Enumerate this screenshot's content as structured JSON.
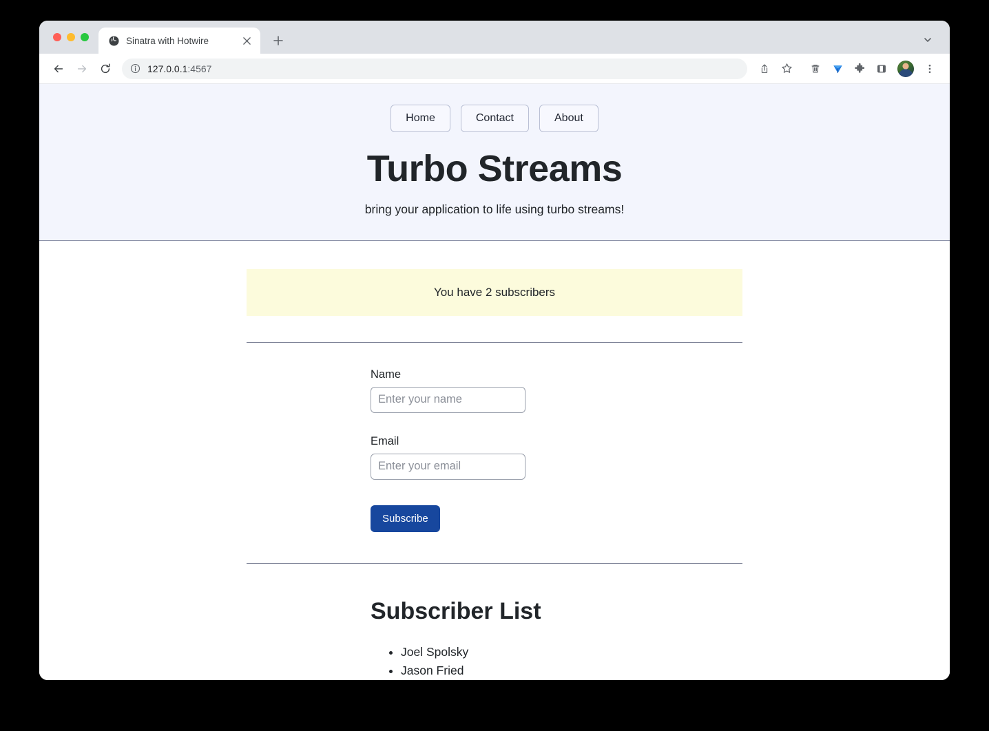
{
  "browser": {
    "tab": {
      "title": "Sinatra with Hotwire",
      "favicon": "globe-icon",
      "close": "✕"
    },
    "new_tab_label": "+",
    "tablist_chevron": "chevron-down-icon",
    "toolbar": {
      "back": "back-arrow-icon",
      "forward": "forward-arrow-icon",
      "reload": "reload-icon",
      "site_info": "info-circle-icon",
      "url_host": "127.0.0.1",
      "url_port": ":4567",
      "share": "share-icon",
      "bookmark": "star-icon",
      "trash": "trash-icon",
      "gem_extension": "blue-gem-icon",
      "extensions": "puzzle-piece-icon",
      "side_panel": "side-panel-icon",
      "profile": "avatar-icon",
      "menu": "three-dot-menu-icon"
    }
  },
  "page": {
    "nav": [
      {
        "label": "Home"
      },
      {
        "label": "Contact"
      },
      {
        "label": "About"
      }
    ],
    "title": "Turbo Streams",
    "subtitle": "bring your application to life using turbo streams!",
    "alert": "You have 2 subscribers",
    "form": {
      "name_label": "Name",
      "name_placeholder": "Enter your name",
      "name_value": "",
      "email_label": "Email",
      "email_placeholder": "Enter your email",
      "email_value": "",
      "submit_label": "Subscribe"
    },
    "list": {
      "heading": "Subscriber List",
      "items": [
        {
          "name": "Joel Spolsky"
        },
        {
          "name": "Jason Fried"
        }
      ]
    }
  },
  "colors": {
    "hero_bg": "#f3f5fd",
    "alert_bg": "#fcfbdc",
    "button_blue": "#17479e"
  }
}
